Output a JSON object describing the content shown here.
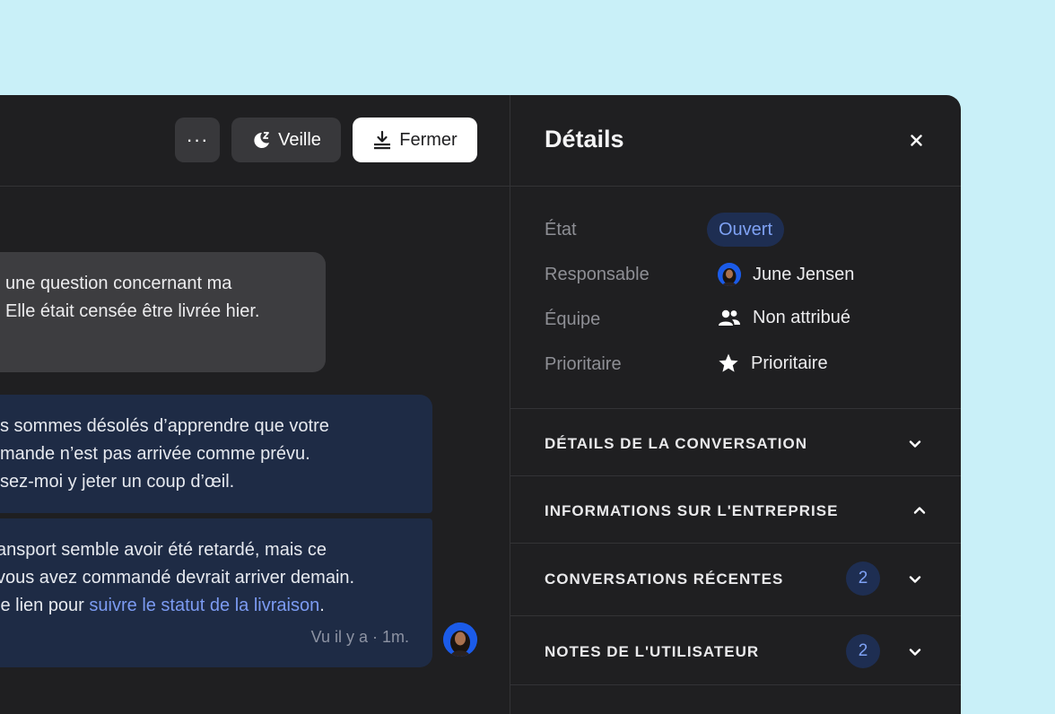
{
  "toolbar": {
    "more_label": "···",
    "snooze_label": "Veille",
    "close_label": "Fermer"
  },
  "messages": {
    "incoming_lines": [
      "une question concernant ma",
      "Elle était censée être livrée hier."
    ],
    "outgoing1_lines": [
      "s sommes désolés d’apprendre que votre",
      "mande n’est pas arrivée comme prévu.",
      "sez-moi y jeter un coup d’œil."
    ],
    "outgoing2_lines": [
      "ansport semble avoir été retardé, mais ce",
      "vous avez commandé devrait arriver demain."
    ],
    "outgoing2_link_prefix": "le lien pour ",
    "outgoing2_link": "suivre le statut de la livraison",
    "outgoing2_link_suffix": ".",
    "seen": "Vu il y a · 1m."
  },
  "details": {
    "title": "Détails",
    "state_label": "État",
    "state_value": "Ouvert",
    "assignee_label": "Responsable",
    "assignee_value": "June Jensen",
    "team_label": "Équipe",
    "team_value": "Non attribué",
    "priority_label": "Prioritaire",
    "priority_value": "Prioritaire",
    "sections": [
      {
        "title": "DÉTAILS DE LA CONVERSATION",
        "count": "",
        "expanded": false
      },
      {
        "title": "INFORMATIONS SUR L'ENTREPRISE",
        "count": "",
        "expanded": true
      },
      {
        "title": "CONVERSATIONS RÉCENTES",
        "count": "2",
        "expanded": false
      },
      {
        "title": "NOTES DE L'UTILISATEUR",
        "count": "2",
        "expanded": false
      }
    ]
  },
  "colors": {
    "background": "#c9f0f8",
    "window": "#1f1f21",
    "outgoing_bubble": "#1e2b45",
    "incoming_bubble": "#3d3d40",
    "accent": "#7fa2f5",
    "avatar": "#1b5be8"
  },
  "icons": {
    "more": "more-dots-icon",
    "snooze": "moon-z-icon",
    "close_conv": "close-tray-icon",
    "close_panel": "close-icon",
    "team": "people-icon",
    "priority": "star-icon",
    "chevron": "chevron-icon"
  }
}
